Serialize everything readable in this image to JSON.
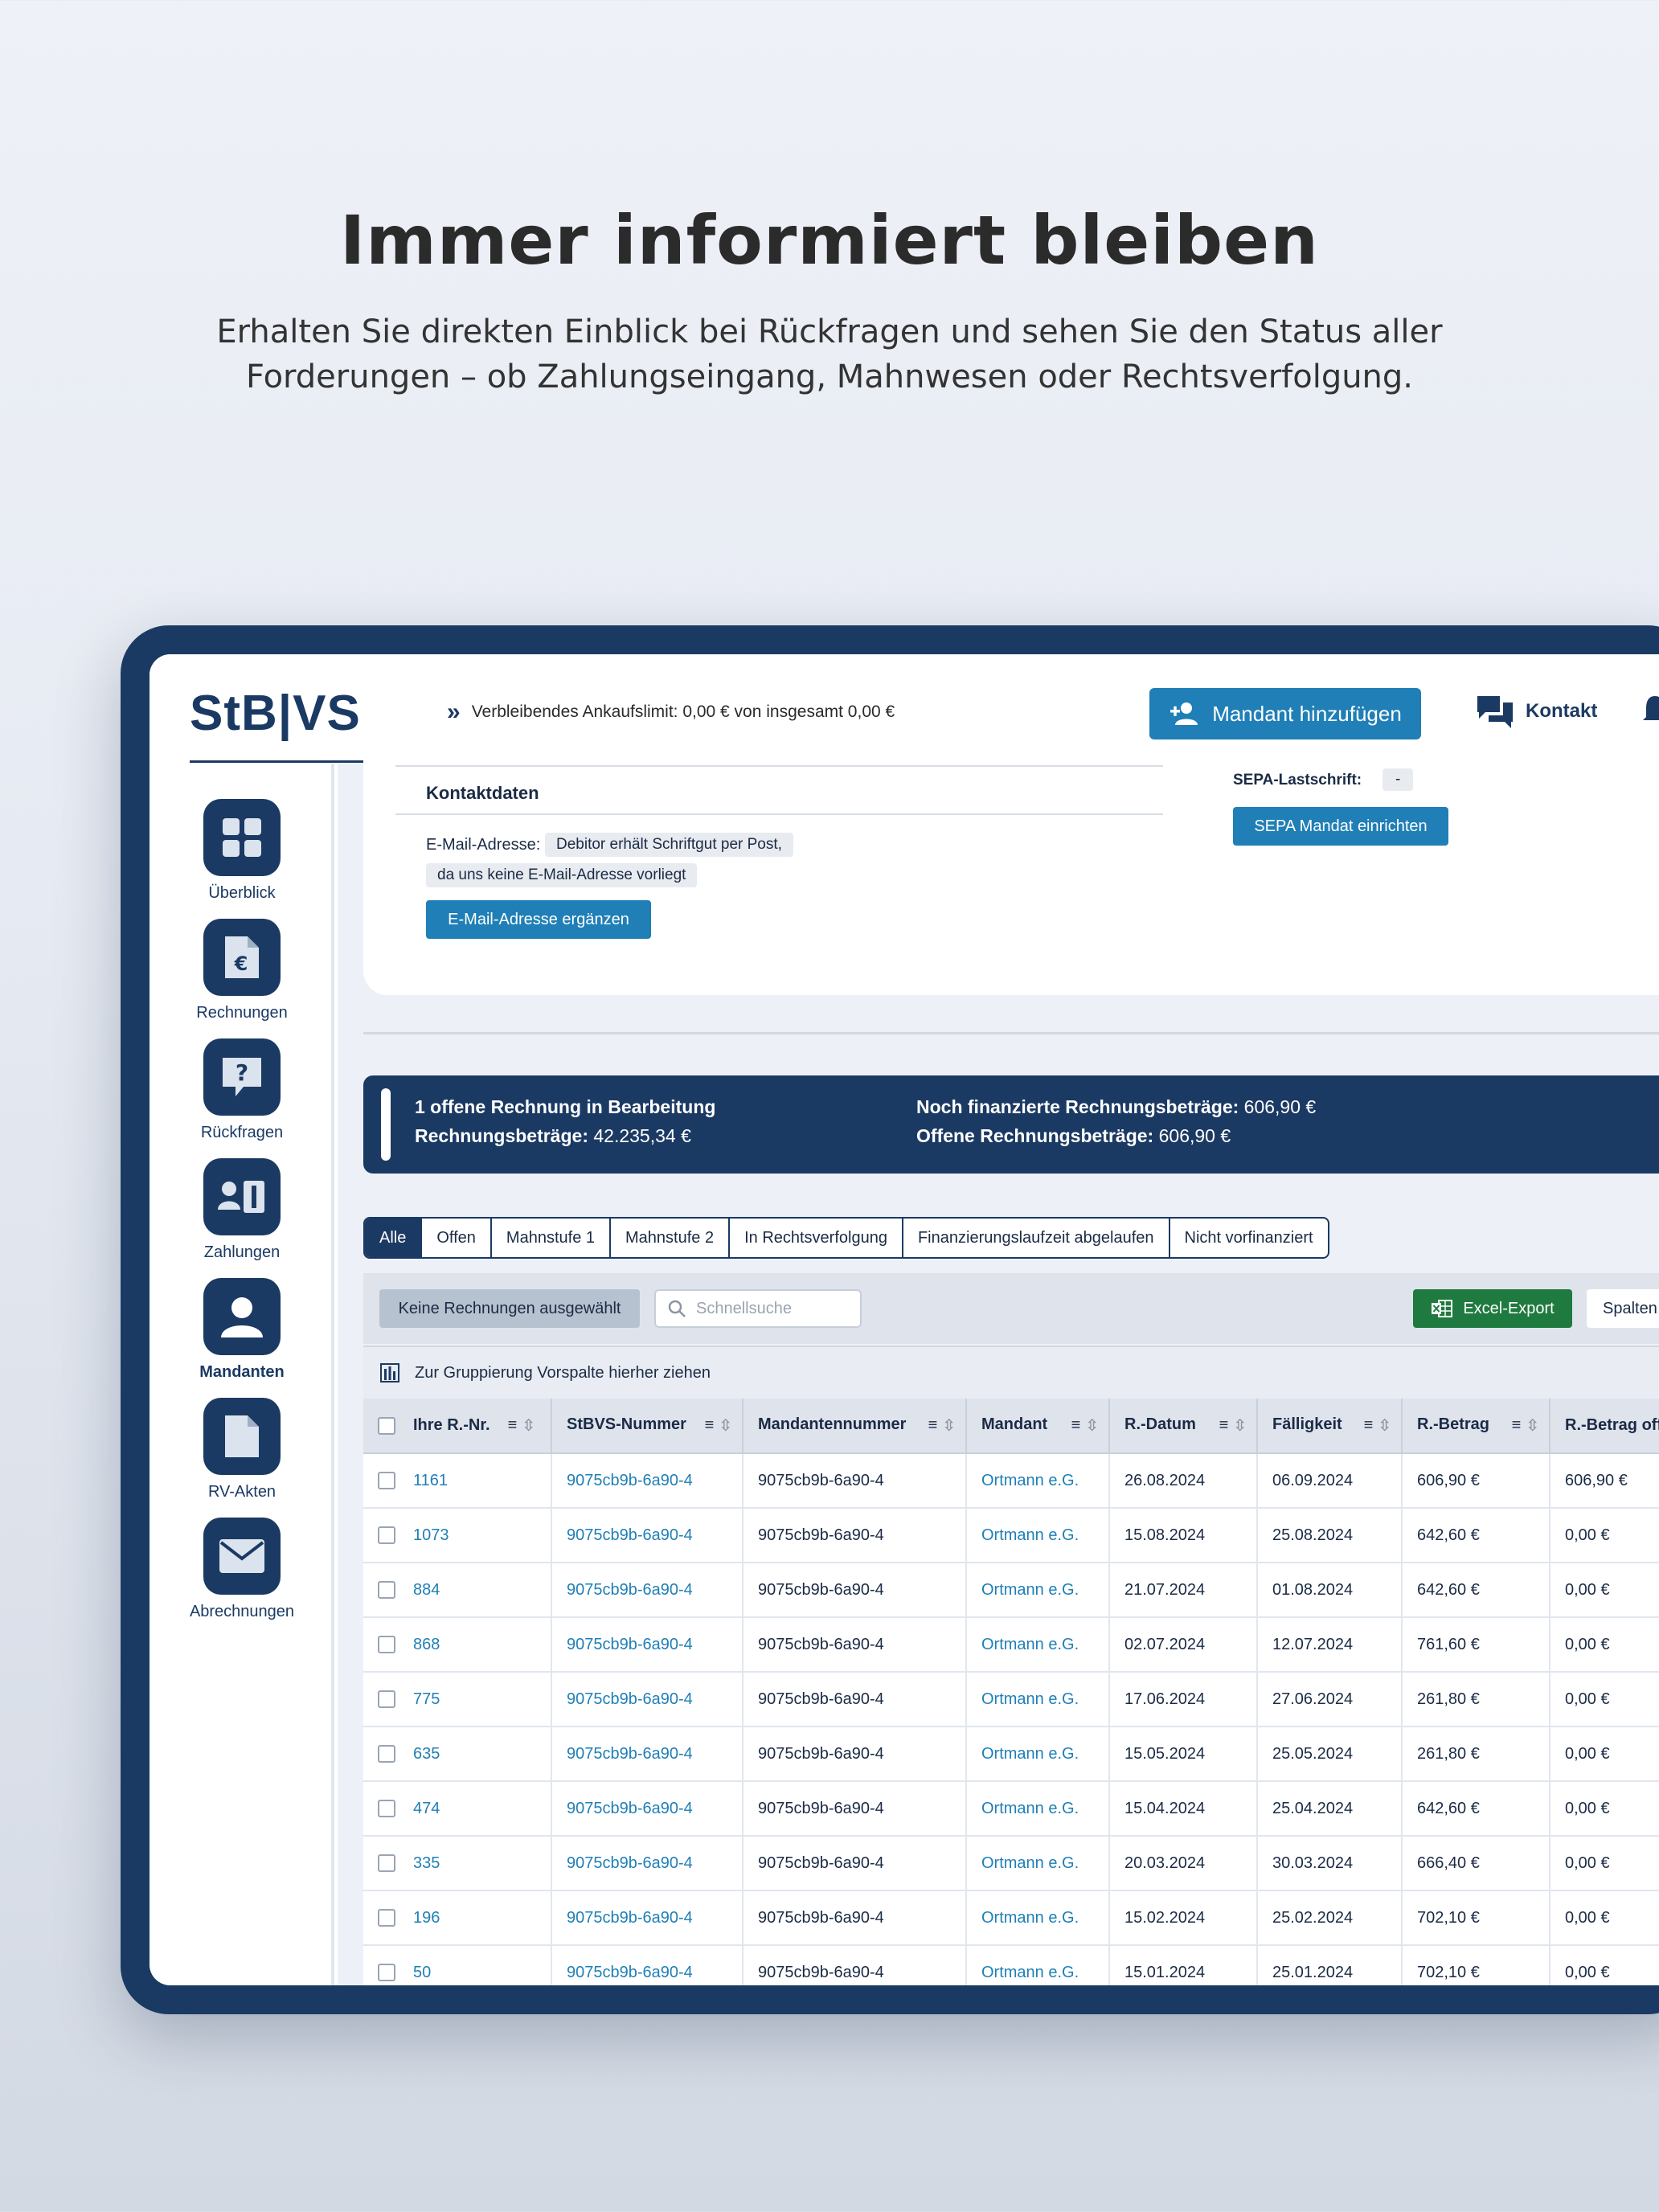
{
  "hero": {
    "title": "Immer informiert bleiben",
    "subtitle_line1": "Erhalten Sie direkten Einblick bei Rückfragen und sehen Sie den Status aller",
    "subtitle_line2": "Forderungen – ob Zahlungseingang, Mahnwesen oder Rechtsverfolgung."
  },
  "header": {
    "logo": "StB|VS",
    "limit_text": "Verbleibendes Ankaufslimit: 0,00 € von insgesamt 0,00 €",
    "add_client_label": "Mandant hinzufügen",
    "contact_label": "Kontakt"
  },
  "sidebar": {
    "items": [
      {
        "label": "Überblick",
        "icon": "grid-icon"
      },
      {
        "label": "Rechnungen",
        "icon": "invoice-euro-icon"
      },
      {
        "label": "Rückfragen",
        "icon": "question-bubble-icon"
      },
      {
        "label": "Zahlungen",
        "icon": "payments-icon"
      },
      {
        "label": "Mandanten",
        "icon": "user-icon"
      },
      {
        "label": "RV-Akten",
        "icon": "file-icon"
      },
      {
        "label": "Abrechnungen",
        "icon": "envelope-icon"
      }
    ],
    "active": "Mandanten"
  },
  "contact": {
    "title": "Kontaktdaten",
    "email_label": "E-Mail-Adresse:",
    "email_value_line1": "Debitor erhält Schriftgut per Post,",
    "email_value_line2": "da uns keine E-Mail-Adresse vorliegt",
    "email_button": "E-Mail-Adresse ergänzen",
    "sepa_label": "SEPA-Lastschrift:",
    "sepa_value": "-",
    "sepa_button": "SEPA Mandat einrichten"
  },
  "summary": {
    "open_invoices": "1 offene Rechnung in Bearbeitung",
    "invoice_amounts_label": "Rechnungsbeträge:",
    "invoice_amounts_value": "42.235,34 €",
    "financed_label": "Noch finanzierte Rechnungsbeträge:",
    "financed_value": "606,90 €",
    "open_amounts_label": "Offene Rechnungsbeträge:",
    "open_amounts_value": "606,90 €"
  },
  "tabs": [
    "Alle",
    "Offen",
    "Mahnstufe 1",
    "Mahnstufe 2",
    "In Rechtsverfolgung",
    "Finanzierungslaufzeit abgelaufen",
    "Nicht vorfinanziert"
  ],
  "toolbar": {
    "selection_label": "Keine Rechnungen ausgewählt",
    "search_placeholder": "Schnellsuche",
    "excel_label": "Excel-Export",
    "columns_label": "Spalten"
  },
  "grouping_hint": "Zur Gruppierung Vorspalte hierher ziehen",
  "table": {
    "columns": [
      "Ihre R.-Nr.",
      "StBVS-Nummer",
      "Mandantennummer",
      "Mandant",
      "R.-Datum",
      "Fälligkeit",
      "R.-Betrag",
      "R.-Betrag offen"
    ],
    "rows": [
      [
        "1161",
        "9075cb9b-6a90-4",
        "9075cb9b-6a90-4",
        "Ortmann e.G.",
        "26.08.2024",
        "06.09.2024",
        "606,90 €",
        "606,90 €"
      ],
      [
        "1073",
        "9075cb9b-6a90-4",
        "9075cb9b-6a90-4",
        "Ortmann e.G.",
        "15.08.2024",
        "25.08.2024",
        "642,60 €",
        "0,00 €"
      ],
      [
        "884",
        "9075cb9b-6a90-4",
        "9075cb9b-6a90-4",
        "Ortmann e.G.",
        "21.07.2024",
        "01.08.2024",
        "642,60 €",
        "0,00 €"
      ],
      [
        "868",
        "9075cb9b-6a90-4",
        "9075cb9b-6a90-4",
        "Ortmann e.G.",
        "02.07.2024",
        "12.07.2024",
        "761,60 €",
        "0,00 €"
      ],
      [
        "775",
        "9075cb9b-6a90-4",
        "9075cb9b-6a90-4",
        "Ortmann e.G.",
        "17.06.2024",
        "27.06.2024",
        "261,80 €",
        "0,00 €"
      ],
      [
        "635",
        "9075cb9b-6a90-4",
        "9075cb9b-6a90-4",
        "Ortmann e.G.",
        "15.05.2024",
        "25.05.2024",
        "261,80 €",
        "0,00 €"
      ],
      [
        "474",
        "9075cb9b-6a90-4",
        "9075cb9b-6a90-4",
        "Ortmann e.G.",
        "15.04.2024",
        "25.04.2024",
        "642,60 €",
        "0,00 €"
      ],
      [
        "335",
        "9075cb9b-6a90-4",
        "9075cb9b-6a90-4",
        "Ortmann e.G.",
        "20.03.2024",
        "30.03.2024",
        "666,40 €",
        "0,00 €"
      ],
      [
        "196",
        "9075cb9b-6a90-4",
        "9075cb9b-6a90-4",
        "Ortmann e.G.",
        "15.02.2024",
        "25.02.2024",
        "702,10 €",
        "0,00 €"
      ],
      [
        "50",
        "9075cb9b-6a90-4",
        "9075cb9b-6a90-4",
        "Ortmann e.G.",
        "15.01.2024",
        "25.01.2024",
        "702,10 €",
        "0,00 €"
      ]
    ]
  },
  "colors": {
    "navy": "#1b3a63",
    "accent_blue": "#1f7fb6",
    "excel_green": "#1f7a3f"
  }
}
